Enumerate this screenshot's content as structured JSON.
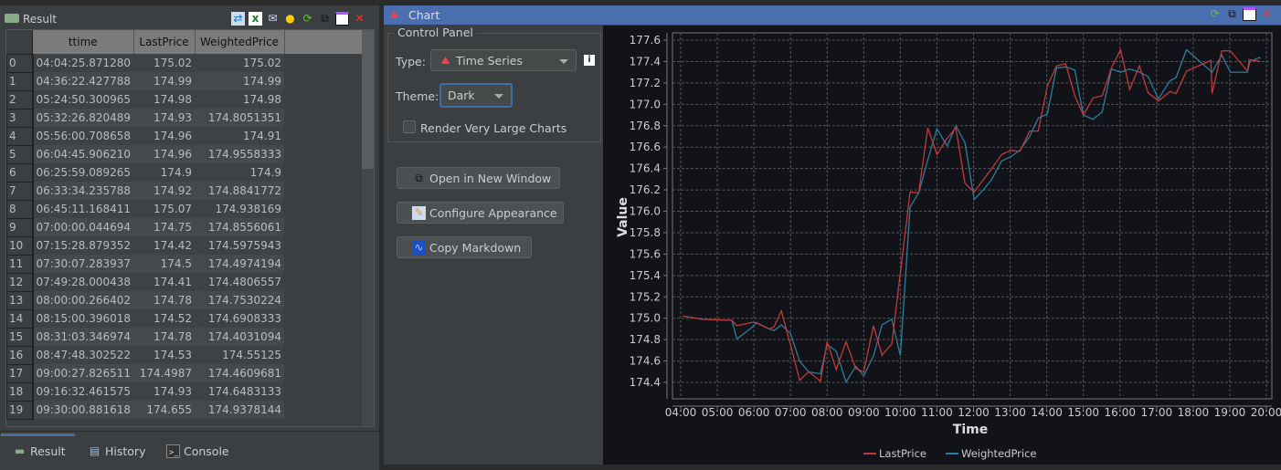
{
  "result_panel": {
    "title": "Result",
    "toolbar_icons": [
      "export-icon",
      "excel-icon",
      "email-icon",
      "duck-icon",
      "refresh-icon",
      "popout-icon",
      "maximize-icon",
      "close-icon"
    ],
    "columns": [
      "ttime",
      "LastPrice",
      "WeightedPrice"
    ],
    "rows": [
      [
        "0",
        "04:04:25.871280",
        "175.02",
        "175.02"
      ],
      [
        "1",
        "04:36:22.427788",
        "174.99",
        "174.99"
      ],
      [
        "2",
        "05:24:50.300965",
        "174.98",
        "174.98"
      ],
      [
        "3",
        "05:32:26.820489",
        "174.93",
        "174.8051351"
      ],
      [
        "4",
        "05:56:00.708658",
        "174.96",
        "174.91"
      ],
      [
        "5",
        "06:04:45.906210",
        "174.96",
        "174.9558333"
      ],
      [
        "6",
        "06:25:59.089265",
        "174.9",
        "174.9"
      ],
      [
        "7",
        "06:33:34.235788",
        "174.92",
        "174.8841772"
      ],
      [
        "8",
        "06:45:11.168411",
        "175.07",
        "174.938169"
      ],
      [
        "9",
        "07:00:00.044694",
        "174.75",
        "174.8556061"
      ],
      [
        "10",
        "07:15:28.879352",
        "174.42",
        "174.5975943"
      ],
      [
        "11",
        "07:30:07.283937",
        "174.5",
        "174.4974194"
      ],
      [
        "12",
        "07:49:28.000438",
        "174.41",
        "174.4806557"
      ],
      [
        "13",
        "08:00:00.266402",
        "174.78",
        "174.7530224"
      ],
      [
        "14",
        "08:15:00.396018",
        "174.52",
        "174.6908333"
      ],
      [
        "15",
        "08:31:03.346974",
        "174.78",
        "174.4031094"
      ],
      [
        "16",
        "08:47:48.302522",
        "174.53",
        "174.55125"
      ],
      [
        "17",
        "09:00:27.826511",
        "174.4987",
        "174.4609681"
      ],
      [
        "18",
        "09:16:32.461575",
        "174.93",
        "174.6483133"
      ],
      [
        "19",
        "09:30:00.881618",
        "174.655",
        "174.9378144"
      ]
    ],
    "tabs": [
      {
        "label": "Result",
        "icon": "result-icon",
        "selected": true
      },
      {
        "label": "History",
        "icon": "history-icon"
      },
      {
        "label": "Console",
        "icon": "console-icon"
      }
    ]
  },
  "chart_panel": {
    "title": "Chart",
    "toolbar_icons": [
      "refresh-icon",
      "popout-icon",
      "maximize-icon",
      "close-icon"
    ],
    "control_panel": {
      "title": "Control Panel",
      "type_label": "Type:",
      "type_value": "Time Series",
      "theme_label": "Theme:",
      "theme_value": "Dark",
      "render_large_label": "Render Very Large Charts",
      "render_large_checked": false
    },
    "buttons": {
      "open_new_window": "Open in New Window",
      "configure_appearance": "Configure Appearance",
      "copy_markdown": "Copy Markdown"
    }
  },
  "chart_data": {
    "type": "line",
    "xlabel": "Time",
    "ylabel": "Value",
    "xlim": [
      "04:00",
      "20:00"
    ],
    "ylim": [
      174.4,
      177.6
    ],
    "x_ticks": [
      "04:00",
      "05:00",
      "06:00",
      "07:00",
      "08:00",
      "09:00",
      "10:00",
      "11:00",
      "12:00",
      "13:00",
      "14:00",
      "15:00",
      "16:00",
      "17:00",
      "18:00",
      "19:00",
      "20:00"
    ],
    "y_ticks": [
      "174.4",
      "174.6",
      "174.8",
      "175.0",
      "175.2",
      "175.4",
      "175.6",
      "175.8",
      "176.0",
      "176.2",
      "176.4",
      "176.6",
      "176.8",
      "177.0",
      "177.2",
      "177.4",
      "177.6"
    ],
    "grid": true,
    "legend": "bottom",
    "series": [
      {
        "name": "LastPrice",
        "color": "#c0393b",
        "points": [
          [
            "04:04",
            175.02
          ],
          [
            "04:36",
            174.99
          ],
          [
            "05:24",
            174.98
          ],
          [
            "05:32",
            174.93
          ],
          [
            "05:56",
            174.96
          ],
          [
            "06:04",
            174.96
          ],
          [
            "06:25",
            174.9
          ],
          [
            "06:33",
            174.92
          ],
          [
            "06:45",
            175.07
          ],
          [
            "07:00",
            174.75
          ],
          [
            "07:15",
            174.42
          ],
          [
            "07:30",
            174.5
          ],
          [
            "07:49",
            174.41
          ],
          [
            "08:00",
            174.78
          ],
          [
            "08:15",
            174.52
          ],
          [
            "08:31",
            174.78
          ],
          [
            "08:47",
            174.53
          ],
          [
            "09:00",
            174.4987
          ],
          [
            "09:16",
            174.93
          ],
          [
            "09:30",
            174.655
          ],
          [
            "09:46",
            174.76
          ],
          [
            "10:16",
            176.18
          ],
          [
            "10:30",
            176.17
          ],
          [
            "10:45",
            176.78
          ],
          [
            "11:00",
            176.53
          ],
          [
            "11:15",
            176.67
          ],
          [
            "11:31",
            176.78
          ],
          [
            "11:46",
            176.26
          ],
          [
            "12:01",
            176.18
          ],
          [
            "12:30",
            176.4
          ],
          [
            "12:46",
            176.53
          ],
          [
            "13:01",
            176.57
          ],
          [
            "13:16",
            176.56
          ],
          [
            "13:32",
            176.75
          ],
          [
            "13:46",
            176.75
          ],
          [
            "14:01",
            177.17
          ],
          [
            "14:16",
            177.36
          ],
          [
            "14:31",
            177.38
          ],
          [
            "14:46",
            177.08
          ],
          [
            "15:00",
            176.9
          ],
          [
            "15:16",
            177.06
          ],
          [
            "15:31",
            177.08
          ],
          [
            "15:46",
            177.34
          ],
          [
            "16:01",
            177.51
          ],
          [
            "16:16",
            177.14
          ],
          [
            "16:32",
            177.36
          ],
          [
            "16:46",
            177.11
          ],
          [
            "17:03",
            177.03
          ],
          [
            "17:22",
            177.12
          ],
          [
            "17:32",
            177.1
          ],
          [
            "17:49",
            177.31
          ],
          [
            "18:29",
            177.41
          ],
          [
            "18:31",
            177.1
          ],
          [
            "18:47",
            177.5
          ],
          [
            "19:01",
            177.5
          ],
          [
            "19:29",
            177.31
          ],
          [
            "19:32",
            177.42
          ],
          [
            "19:50",
            177.4
          ]
        ]
      },
      {
        "name": "WeightedPrice",
        "color": "#2d7c99",
        "points": [
          [
            "04:04",
            175.02
          ],
          [
            "04:36",
            174.99
          ],
          [
            "05:24",
            174.98
          ],
          [
            "05:32",
            174.805
          ],
          [
            "05:56",
            174.91
          ],
          [
            "06:04",
            174.956
          ],
          [
            "06:25",
            174.9
          ],
          [
            "06:33",
            174.884
          ],
          [
            "06:45",
            174.938
          ],
          [
            "07:00",
            174.856
          ],
          [
            "07:15",
            174.598
          ],
          [
            "07:30",
            174.497
          ],
          [
            "07:49",
            174.481
          ],
          [
            "08:00",
            174.753
          ],
          [
            "08:15",
            174.691
          ],
          [
            "08:31",
            174.403
          ],
          [
            "08:47",
            174.551
          ],
          [
            "09:00",
            174.461
          ],
          [
            "09:16",
            174.648
          ],
          [
            "09:30",
            174.938
          ],
          [
            "09:46",
            174.99
          ],
          [
            "10:00",
            174.65
          ],
          [
            "10:16",
            176.04
          ],
          [
            "10:30",
            176.17
          ],
          [
            "10:45",
            176.48
          ],
          [
            "11:00",
            176.77
          ],
          [
            "11:17",
            176.61
          ],
          [
            "11:31",
            176.8
          ],
          [
            "11:46",
            176.64
          ],
          [
            "12:01",
            176.11
          ],
          [
            "12:16",
            176.2
          ],
          [
            "12:30",
            176.3
          ],
          [
            "12:46",
            176.47
          ],
          [
            "13:01",
            176.51
          ],
          [
            "13:16",
            176.57
          ],
          [
            "13:32",
            176.7
          ],
          [
            "13:46",
            176.87
          ],
          [
            "14:01",
            176.91
          ],
          [
            "14:16",
            177.34
          ],
          [
            "14:31",
            177.35
          ],
          [
            "14:46",
            177.32
          ],
          [
            "15:00",
            176.9
          ],
          [
            "15:16",
            176.86
          ],
          [
            "15:31",
            176.93
          ],
          [
            "15:46",
            177.33
          ],
          [
            "16:01",
            177.3
          ],
          [
            "16:16",
            177.33
          ],
          [
            "16:32",
            177.3
          ],
          [
            "16:46",
            177.26
          ],
          [
            "17:03",
            177.05
          ],
          [
            "17:22",
            177.22
          ],
          [
            "17:32",
            177.25
          ],
          [
            "17:49",
            177.51
          ],
          [
            "18:31",
            177.3
          ],
          [
            "18:47",
            177.46
          ],
          [
            "19:01",
            177.3
          ],
          [
            "19:29",
            177.3
          ],
          [
            "19:33",
            177.4
          ],
          [
            "19:50",
            177.44
          ]
        ]
      }
    ]
  }
}
